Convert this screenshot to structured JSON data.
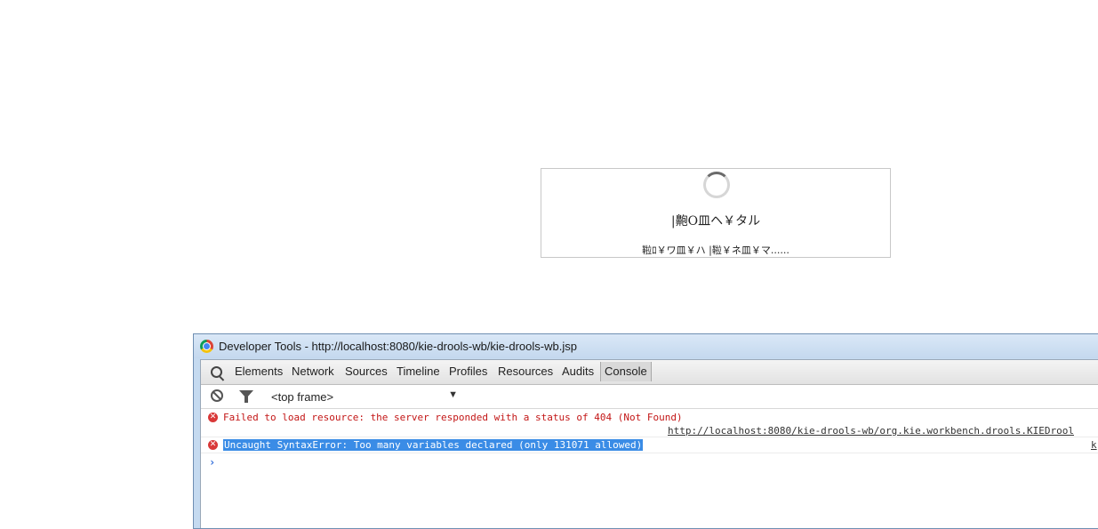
{
  "loading": {
    "title": "|䶌O皿ヘ￥タル",
    "message": "鞡ﾛ￥ワ皿￥ハ |鞡￥ネ皿￥マ......"
  },
  "devtools": {
    "window_title": "Developer Tools - http://localhost:8080/kie-drools-wb/kie-drools-wb.jsp",
    "tabs": [
      "Elements",
      "Network",
      "Sources",
      "Timeline",
      "Profiles",
      "Resources",
      "Audits",
      "Console"
    ],
    "active_tab": "Console",
    "frame_select": "<top frame>",
    "messages": [
      {
        "text": "Failed to load resource: the server responded with a status of 404 (Not Found)",
        "source": "http://localhost:8080/kie-drools-wb/org.kie.workbench.drools.KIEDrool"
      },
      {
        "text": "Uncaught SyntaxError: Too many variables declared (only 131071 allowed)",
        "source": "k"
      }
    ],
    "prompt": "›"
  }
}
